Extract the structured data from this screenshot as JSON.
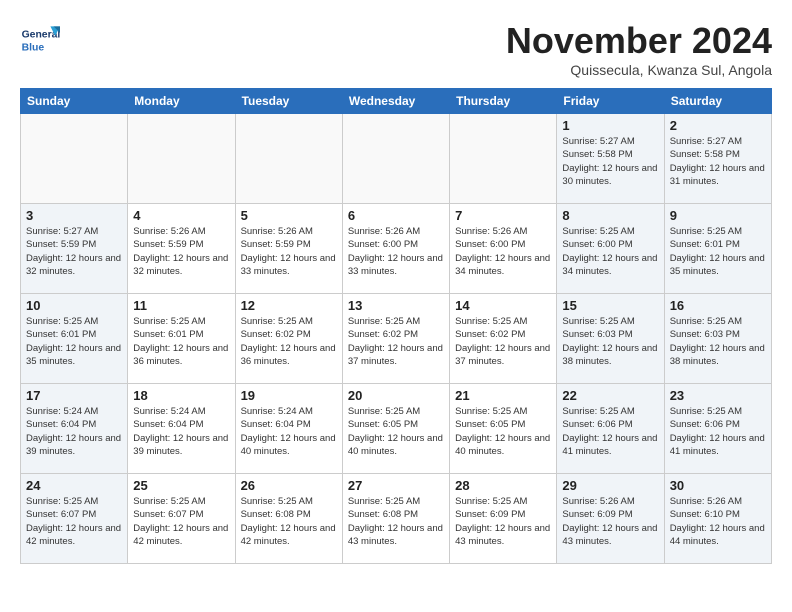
{
  "header": {
    "logo_line1": "General",
    "logo_line2": "Blue",
    "month_title": "November 2024",
    "location": "Quissecula, Kwanza Sul, Angola"
  },
  "weekdays": [
    "Sunday",
    "Monday",
    "Tuesday",
    "Wednesday",
    "Thursday",
    "Friday",
    "Saturday"
  ],
  "weeks": [
    [
      {
        "day": "",
        "info": "",
        "type": "empty"
      },
      {
        "day": "",
        "info": "",
        "type": "empty"
      },
      {
        "day": "",
        "info": "",
        "type": "empty"
      },
      {
        "day": "",
        "info": "",
        "type": "empty"
      },
      {
        "day": "",
        "info": "",
        "type": "empty"
      },
      {
        "day": "1",
        "info": "Sunrise: 5:27 AM\nSunset: 5:58 PM\nDaylight: 12 hours and 30 minutes.",
        "type": "weekend"
      },
      {
        "day": "2",
        "info": "Sunrise: 5:27 AM\nSunset: 5:58 PM\nDaylight: 12 hours and 31 minutes.",
        "type": "weekend"
      }
    ],
    [
      {
        "day": "3",
        "info": "Sunrise: 5:27 AM\nSunset: 5:59 PM\nDaylight: 12 hours and 32 minutes.",
        "type": "weekend"
      },
      {
        "day": "4",
        "info": "Sunrise: 5:26 AM\nSunset: 5:59 PM\nDaylight: 12 hours and 32 minutes.",
        "type": "weekday"
      },
      {
        "day": "5",
        "info": "Sunrise: 5:26 AM\nSunset: 5:59 PM\nDaylight: 12 hours and 33 minutes.",
        "type": "weekday"
      },
      {
        "day": "6",
        "info": "Sunrise: 5:26 AM\nSunset: 6:00 PM\nDaylight: 12 hours and 33 minutes.",
        "type": "weekday"
      },
      {
        "day": "7",
        "info": "Sunrise: 5:26 AM\nSunset: 6:00 PM\nDaylight: 12 hours and 34 minutes.",
        "type": "weekday"
      },
      {
        "day": "8",
        "info": "Sunrise: 5:25 AM\nSunset: 6:00 PM\nDaylight: 12 hours and 34 minutes.",
        "type": "weekend"
      },
      {
        "day": "9",
        "info": "Sunrise: 5:25 AM\nSunset: 6:01 PM\nDaylight: 12 hours and 35 minutes.",
        "type": "weekend"
      }
    ],
    [
      {
        "day": "10",
        "info": "Sunrise: 5:25 AM\nSunset: 6:01 PM\nDaylight: 12 hours and 35 minutes.",
        "type": "weekend"
      },
      {
        "day": "11",
        "info": "Sunrise: 5:25 AM\nSunset: 6:01 PM\nDaylight: 12 hours and 36 minutes.",
        "type": "weekday"
      },
      {
        "day": "12",
        "info": "Sunrise: 5:25 AM\nSunset: 6:02 PM\nDaylight: 12 hours and 36 minutes.",
        "type": "weekday"
      },
      {
        "day": "13",
        "info": "Sunrise: 5:25 AM\nSunset: 6:02 PM\nDaylight: 12 hours and 37 minutes.",
        "type": "weekday"
      },
      {
        "day": "14",
        "info": "Sunrise: 5:25 AM\nSunset: 6:02 PM\nDaylight: 12 hours and 37 minutes.",
        "type": "weekday"
      },
      {
        "day": "15",
        "info": "Sunrise: 5:25 AM\nSunset: 6:03 PM\nDaylight: 12 hours and 38 minutes.",
        "type": "weekend"
      },
      {
        "day": "16",
        "info": "Sunrise: 5:25 AM\nSunset: 6:03 PM\nDaylight: 12 hours and 38 minutes.",
        "type": "weekend"
      }
    ],
    [
      {
        "day": "17",
        "info": "Sunrise: 5:24 AM\nSunset: 6:04 PM\nDaylight: 12 hours and 39 minutes.",
        "type": "weekend"
      },
      {
        "day": "18",
        "info": "Sunrise: 5:24 AM\nSunset: 6:04 PM\nDaylight: 12 hours and 39 minutes.",
        "type": "weekday"
      },
      {
        "day": "19",
        "info": "Sunrise: 5:24 AM\nSunset: 6:04 PM\nDaylight: 12 hours and 40 minutes.",
        "type": "weekday"
      },
      {
        "day": "20",
        "info": "Sunrise: 5:25 AM\nSunset: 6:05 PM\nDaylight: 12 hours and 40 minutes.",
        "type": "weekday"
      },
      {
        "day": "21",
        "info": "Sunrise: 5:25 AM\nSunset: 6:05 PM\nDaylight: 12 hours and 40 minutes.",
        "type": "weekday"
      },
      {
        "day": "22",
        "info": "Sunrise: 5:25 AM\nSunset: 6:06 PM\nDaylight: 12 hours and 41 minutes.",
        "type": "weekend"
      },
      {
        "day": "23",
        "info": "Sunrise: 5:25 AM\nSunset: 6:06 PM\nDaylight: 12 hours and 41 minutes.",
        "type": "weekend"
      }
    ],
    [
      {
        "day": "24",
        "info": "Sunrise: 5:25 AM\nSunset: 6:07 PM\nDaylight: 12 hours and 42 minutes.",
        "type": "weekend"
      },
      {
        "day": "25",
        "info": "Sunrise: 5:25 AM\nSunset: 6:07 PM\nDaylight: 12 hours and 42 minutes.",
        "type": "weekday"
      },
      {
        "day": "26",
        "info": "Sunrise: 5:25 AM\nSunset: 6:08 PM\nDaylight: 12 hours and 42 minutes.",
        "type": "weekday"
      },
      {
        "day": "27",
        "info": "Sunrise: 5:25 AM\nSunset: 6:08 PM\nDaylight: 12 hours and 43 minutes.",
        "type": "weekday"
      },
      {
        "day": "28",
        "info": "Sunrise: 5:25 AM\nSunset: 6:09 PM\nDaylight: 12 hours and 43 minutes.",
        "type": "weekday"
      },
      {
        "day": "29",
        "info": "Sunrise: 5:26 AM\nSunset: 6:09 PM\nDaylight: 12 hours and 43 minutes.",
        "type": "weekend"
      },
      {
        "day": "30",
        "info": "Sunrise: 5:26 AM\nSunset: 6:10 PM\nDaylight: 12 hours and 44 minutes.",
        "type": "weekend"
      }
    ]
  ]
}
